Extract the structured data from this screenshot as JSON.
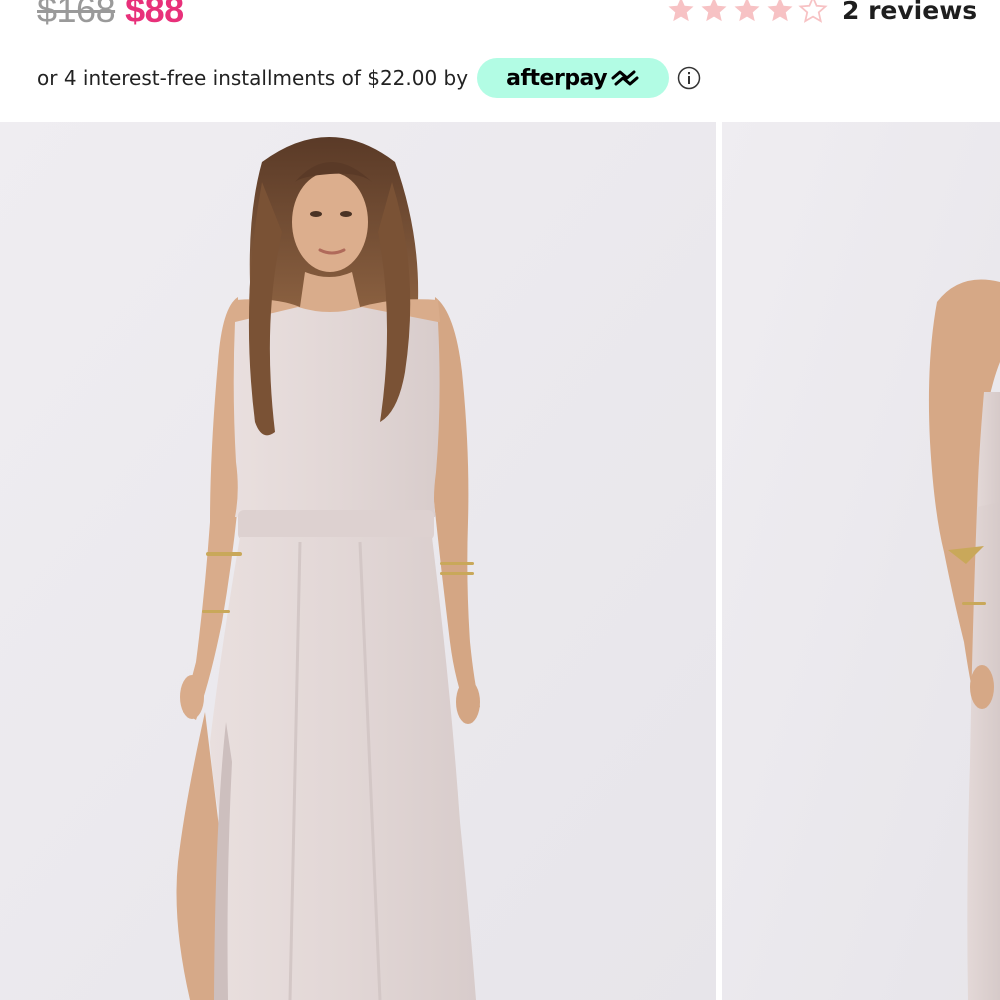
{
  "product": {
    "price_original": "$168",
    "price_sale": "$88",
    "rating_stars": 4,
    "rating_max": 5,
    "reviews_label": "2 reviews"
  },
  "installments": {
    "text": "or 4 interest-free installments of $22.00 by",
    "provider_label": "afterpay",
    "provider_logo_icon": "afterpay-loop-arrows-icon",
    "info_icon": "info-circle-icon"
  },
  "gallery": {
    "images": [
      {
        "alt": "Model wearing sleeveless halter maxi dress with side slit, front view"
      },
      {
        "alt": "Model wearing sleeveless halter maxi dress, side view"
      }
    ]
  },
  "colors": {
    "sale_price": "#e8307a",
    "old_price": "#9a9a9a",
    "star": "#f7c2c4",
    "afterpay_badge": "#b2fce4",
    "image_background": "#eceaee",
    "dress": "#e4d9d8"
  }
}
